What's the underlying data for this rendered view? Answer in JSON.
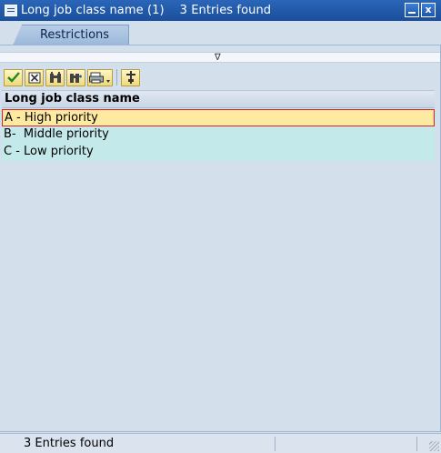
{
  "window": {
    "title": "Long job class name (1)    3 Entries found",
    "close_glyph": "x"
  },
  "tabs": [
    {
      "label": "Restrictions"
    }
  ],
  "collapse": {
    "glyph": "∇"
  },
  "toolbar": {
    "buttons": [
      {
        "icon": "checkmark-icon"
      },
      {
        "icon": "cancel-icon"
      },
      {
        "icon": "binoculars-icon"
      },
      {
        "icon": "find-next-icon"
      },
      {
        "icon": "print-dropdown-icon"
      },
      {
        "icon": "settings-icon"
      }
    ]
  },
  "table": {
    "column_header": "Long job class name",
    "rows": [
      {
        "label": "A - High priority",
        "selected": true
      },
      {
        "label": "B-  Middle priority",
        "selected": false
      },
      {
        "label": "C - Low priority",
        "selected": false
      }
    ]
  },
  "status": {
    "text": "3 Entries found"
  },
  "colors": {
    "titlebar": "#1a4f9c",
    "background": "#d4dfec",
    "selected_row": "#fde9a0",
    "selected_border": "#d8232a",
    "row": "#c4e9ea",
    "toolbar_button": "#f0d97a"
  }
}
